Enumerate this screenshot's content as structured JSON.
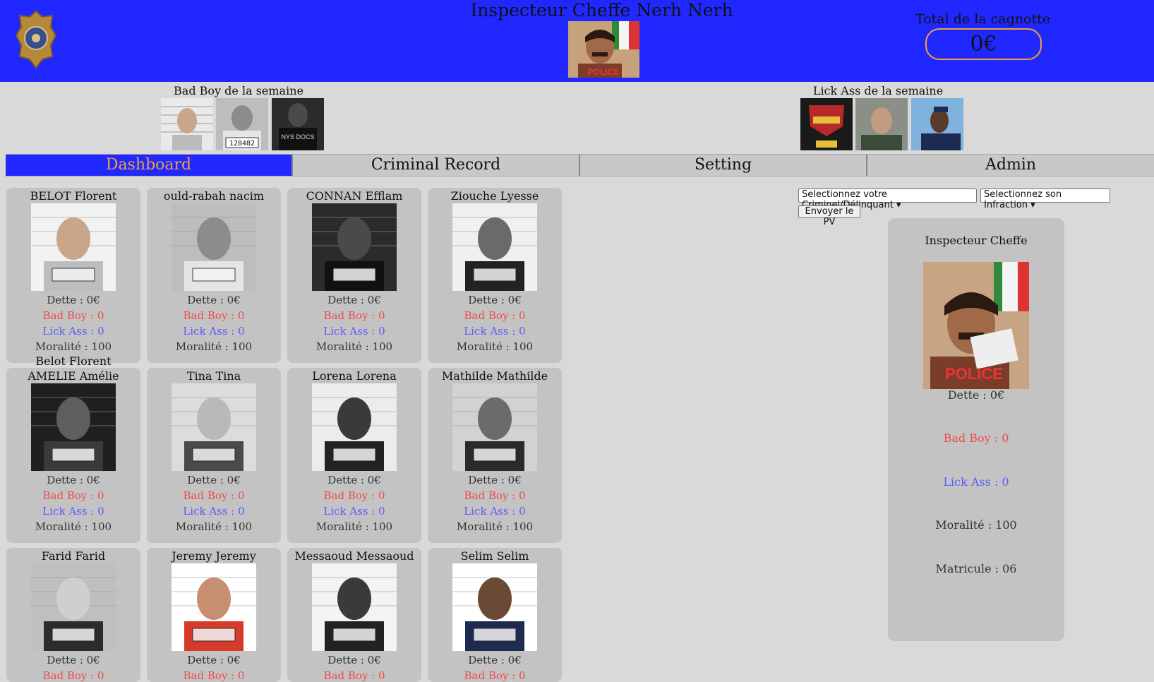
{
  "header": {
    "title": "Inspecteur Cheffe Nerh Nerh",
    "cagnotte_label": "Total de la cagnotte",
    "cagnotte_value": "0€",
    "logo_icon": "police-badge-icon"
  },
  "bad_boy_week": {
    "title": "Bad Boy de la semaine"
  },
  "lick_ass_week": {
    "title": "Lick Ass de la semaine"
  },
  "nav": {
    "tabs": [
      {
        "label": "Dashboard",
        "active": true
      },
      {
        "label": "Criminal Record"
      },
      {
        "label": "Setting"
      },
      {
        "label": "Admin"
      }
    ]
  },
  "cards": [
    {
      "name": "BELOT Florent",
      "dette": "Dette : 0€",
      "bad": "Bad Boy : 0",
      "lick": "Lick Ass : 0",
      "moral": "Moralité : 100"
    },
    {
      "name": "ould-rabah nacim",
      "dette": "Dette : 0€",
      "bad": "Bad Boy : 0",
      "lick": "Lick Ass : 0",
      "moral": "Moralité : 100"
    },
    {
      "name": "CONNAN Efflam",
      "dette": "Dette : 0€",
      "bad": "Bad Boy : 0",
      "lick": "Lick Ass : 0",
      "moral": "Moralité : 100"
    },
    {
      "name": "Ziouche Lyesse",
      "dette": "Dette : 0€",
      "bad": "Bad Boy : 0",
      "lick": "Lick Ass : 0",
      "moral": "Moralité : 100"
    },
    {
      "name": "AMELIE Amélie",
      "dette": "Dette : 0€",
      "bad": "Bad Boy : 0",
      "lick": "Lick Ass : 0",
      "moral": "Moralité : 100"
    },
    {
      "name": "Tina Tina",
      "dette": "Dette : 0€",
      "bad": "Bad Boy : 0",
      "lick": "Lick Ass : 0",
      "moral": "Moralité : 100"
    },
    {
      "name": "Lorena Lorena",
      "dette": "Dette : 0€",
      "bad": "Bad Boy : 0",
      "lick": "Lick Ass : 0",
      "moral": "Moralité : 100"
    },
    {
      "name": "Mathilde Mathilde",
      "dette": "Dette : 0€",
      "bad": "Bad Boy : 0",
      "lick": "Lick Ass : 0",
      "moral": "Moralité : 100"
    },
    {
      "name": "Farid Farid",
      "dette": "Dette : 0€",
      "bad": "Bad Boy : 0"
    },
    {
      "name": "Jeremy Jeremy",
      "dette": "Dette : 0€",
      "bad": "Bad Boy : 0"
    },
    {
      "name": "Messaoud Messaoud",
      "dette": "Dette : 0€",
      "bad": "Bad Boy : 0"
    },
    {
      "name": "Selim Selim",
      "dette": "Dette : 0€",
      "bad": "Bad Boy : 0"
    }
  ],
  "overflow_name": "Belot Florent",
  "form": {
    "criminal_select": "Selectionnez votre Criminel/Délinquant",
    "infraction_select": "Selectionnez son Infraction",
    "submit": "Envoyer le PV"
  },
  "profile": {
    "title": "Inspecteur Cheffe",
    "dette": "Dette : 0€",
    "bad": "Bad Boy : 0",
    "lick": "Lick Ass : 0",
    "moral": "Moralité : 100",
    "matricule": "Matricule : 06"
  },
  "colors": {
    "header_bg": "#2028ff",
    "accent": "#f0a23b",
    "bad": "#f24848",
    "lick": "#5a5aff"
  }
}
